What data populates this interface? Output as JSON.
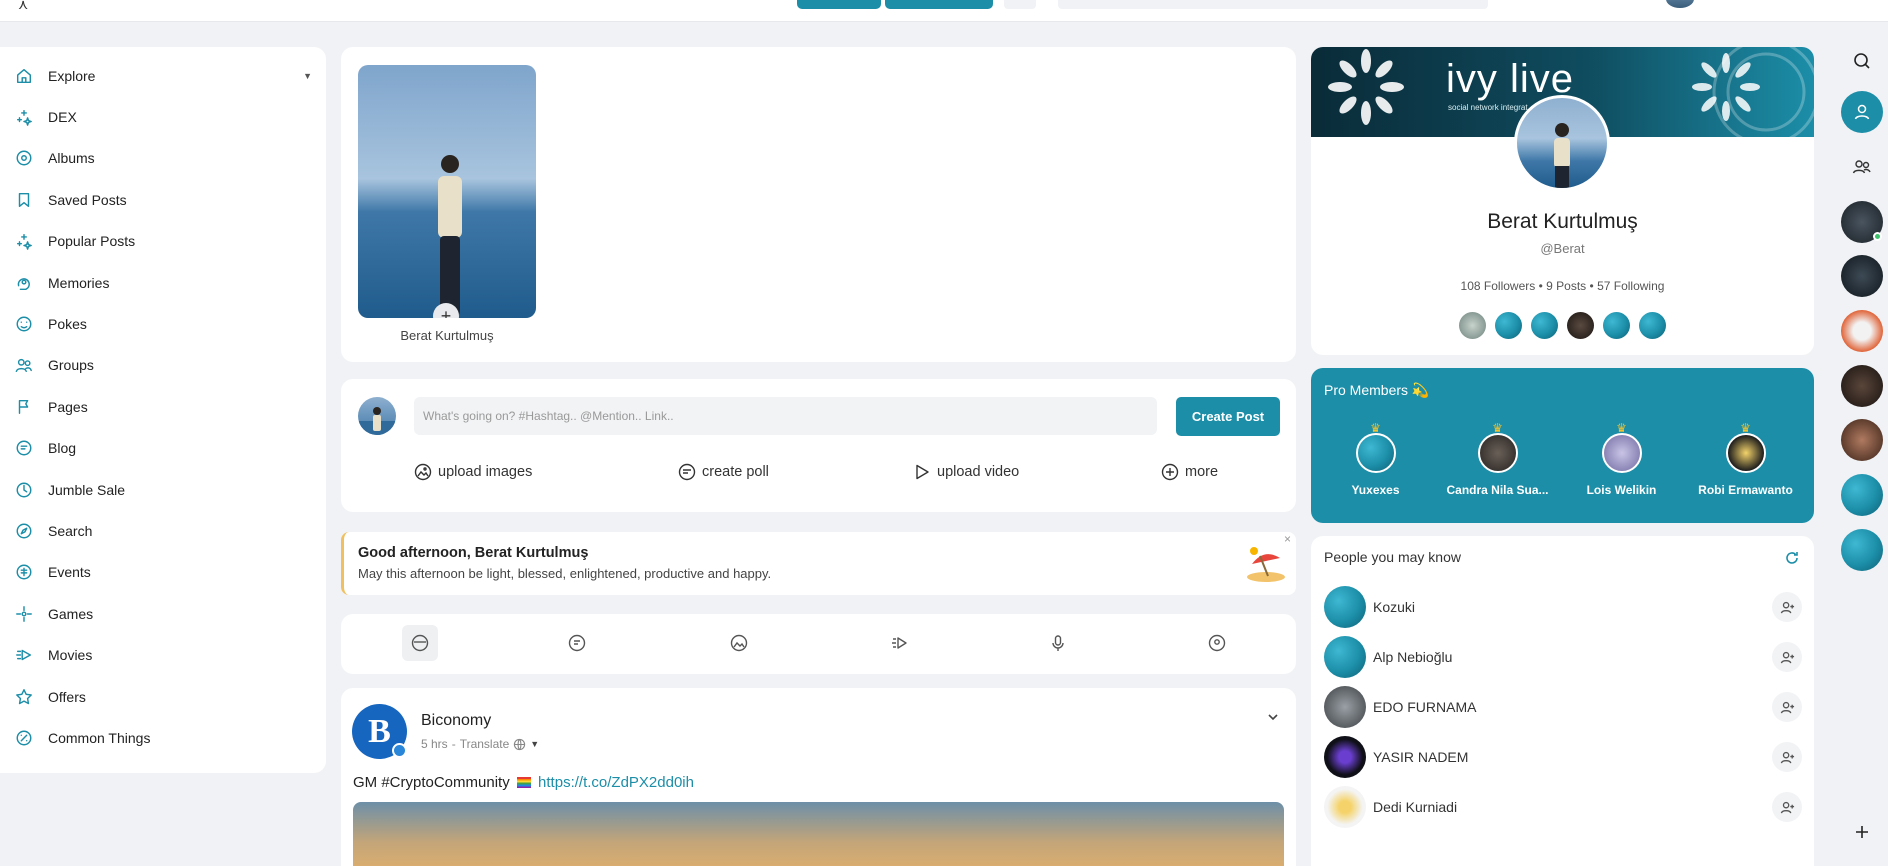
{
  "sidebar": {
    "items": [
      {
        "label": "Explore",
        "icon": "home-icon"
      },
      {
        "label": "DEX",
        "icon": "sparkles-icon"
      },
      {
        "label": "Albums",
        "icon": "albums-icon"
      },
      {
        "label": "Saved Posts",
        "icon": "bookmark-icon"
      },
      {
        "label": "Popular Posts",
        "icon": "sparkles-icon"
      },
      {
        "label": "Memories",
        "icon": "memories-icon"
      },
      {
        "label": "Pokes",
        "icon": "pokes-icon"
      },
      {
        "label": "Groups",
        "icon": "groups-icon"
      },
      {
        "label": "Pages",
        "icon": "flag-icon"
      },
      {
        "label": "Blog",
        "icon": "blog-icon"
      },
      {
        "label": "Jumble Sale",
        "icon": "sale-icon"
      },
      {
        "label": "Search",
        "icon": "compass-icon"
      },
      {
        "label": "Events",
        "icon": "events-icon"
      },
      {
        "label": "Games",
        "icon": "games-icon"
      },
      {
        "label": "Movies",
        "icon": "movies-icon"
      },
      {
        "label": "Offers",
        "icon": "offers-icon"
      },
      {
        "label": "Common Things",
        "icon": "common-things-icon"
      }
    ]
  },
  "stories": {
    "name": "Berat Kurtulmuş",
    "plus": "+"
  },
  "composer": {
    "placeholder": "What's going on? #Hashtag.. @Mention.. Link..",
    "create_label": "Create Post",
    "actions": {
      "upload_images": "upload images",
      "create_poll": "create poll",
      "upload_video": "upload video",
      "more": "more"
    }
  },
  "greeting": {
    "title": "Good afternoon, Berat Kurtulmuş",
    "subtitle": "May this afternoon be light, blessed, enlightened, productive and happy.",
    "close": "×"
  },
  "post": {
    "avatar_letter": "B",
    "author": "Biconomy",
    "time": "5 hrs",
    "separator": "-",
    "translate": "Translate",
    "text_prefix": "GM #CryptoCommunity",
    "link": "https://t.co/ZdPX2dd0ih"
  },
  "profile": {
    "cover_title": "ivy live",
    "cover_subtitle": "social network integrat",
    "name": "Berat Kurtulmuş",
    "handle": "@Berat",
    "followers": "108 Followers",
    "posts": "9 Posts",
    "following": "57 Following",
    "dot": "•"
  },
  "pro_members": {
    "title": "Pro Members 💫",
    "members": [
      {
        "name": "Yuxexes"
      },
      {
        "name": "Candra Nila Sua..."
      },
      {
        "name": "Lois Welikin"
      },
      {
        "name": "Robi Ermawanto"
      }
    ]
  },
  "people_you_may_know": {
    "title": "People you may know",
    "people": [
      {
        "name": "Kozuki"
      },
      {
        "name": "Alp Nebioğlu"
      },
      {
        "name": "EDO FURNAMA"
      },
      {
        "name": "YASIR NADEM"
      },
      {
        "name": "Dedi Kurniadi"
      }
    ]
  },
  "colors": {
    "accent": "#1c8ea8",
    "online": "#3cc36b",
    "greeting_border": "#f0c060"
  }
}
